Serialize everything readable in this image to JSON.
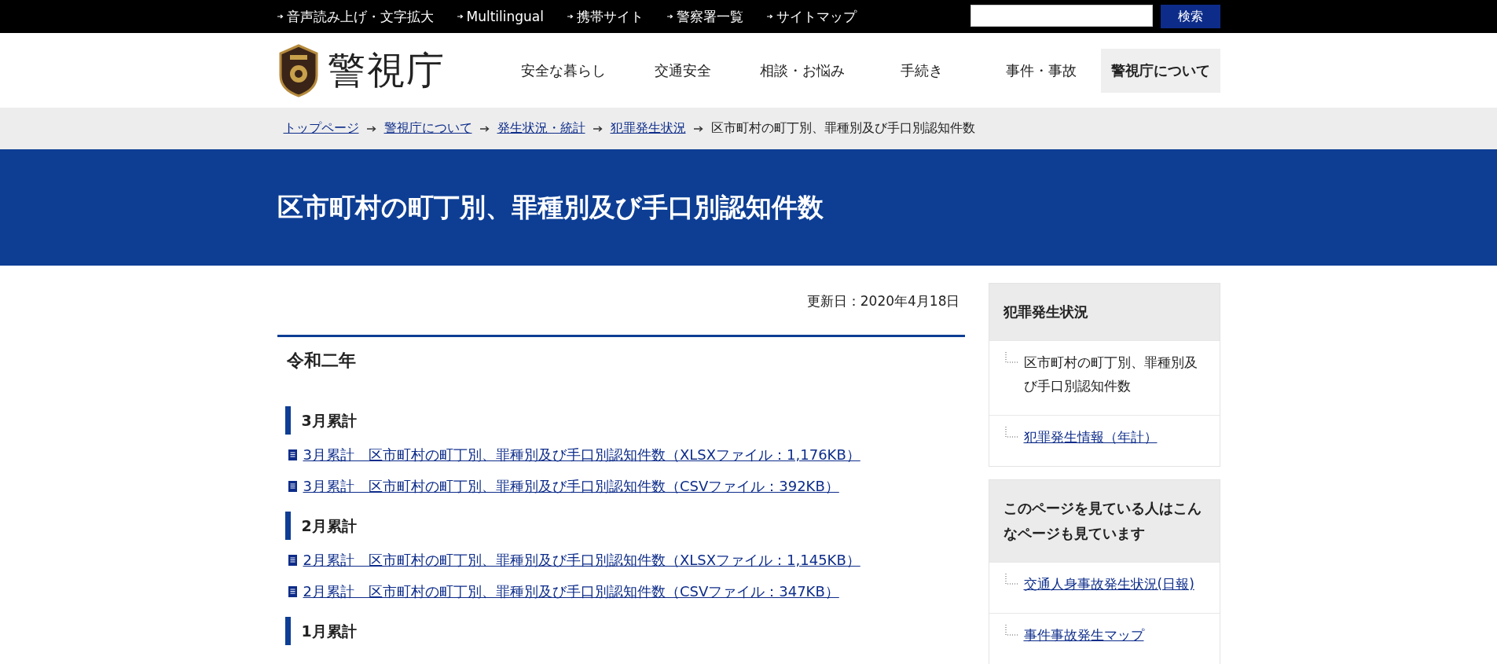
{
  "utility_bar": {
    "links": [
      "音声読み上げ・文字拡大",
      "Multilingual",
      "携帯サイト",
      "警察署一覧",
      "サイトマップ"
    ],
    "search": {
      "button": "検索"
    }
  },
  "header": {
    "logo_text": "警視庁",
    "nav": [
      {
        "label": "安全な暮らし",
        "selected": false
      },
      {
        "label": "交通安全",
        "selected": false
      },
      {
        "label": "相談・お悩み",
        "selected": false
      },
      {
        "label": "手続き",
        "selected": false
      },
      {
        "label": "事件・事故",
        "selected": false
      },
      {
        "label": "警視庁について",
        "selected": true
      }
    ]
  },
  "breadcrumb": [
    {
      "label": "トップページ",
      "kind": "link"
    },
    {
      "label": "警視庁について",
      "kind": "link"
    },
    {
      "label": "発生状況・統計",
      "kind": "link"
    },
    {
      "label": "犯罪発生状況",
      "kind": "link"
    },
    {
      "label": "区市町村の町丁別、罪種別及び手口別認知件数",
      "kind": "current"
    }
  ],
  "page_title": "区市町村の町丁別、罪種別及び手口別認知件数",
  "updated": "更新日：2020年4月18日",
  "year_heading": "令和二年",
  "sections": [
    {
      "heading": "3月累計",
      "files": [
        "3月累計　区市町村の町丁別、罪種別及び手口別認知件数（XLSXファイル：1,176KB）",
        "3月累計　区市町村の町丁別、罪種別及び手口別認知件数（CSVファイル：392KB）"
      ]
    },
    {
      "heading": "2月累計",
      "files": [
        "2月累計　区市町村の町丁別、罪種別及び手口別認知件数（XLSXファイル：1,145KB）",
        "2月累計　区市町村の町丁別、罪種別及び手口別認知件数（CSVファイル：347KB）"
      ]
    },
    {
      "heading": "1月累計"
    }
  ],
  "sidebar": [
    {
      "title": "犯罪発生状況",
      "items": [
        {
          "label": "区市町村の町丁別、罪種別及び手口別認知件数",
          "selected": true
        },
        {
          "label": "犯罪発生情報（年計）",
          "selected": false
        }
      ]
    },
    {
      "title": "このページを見ている人はこんなページも見ています",
      "items": [
        {
          "label": "交通人身事故発生状況(日報)",
          "selected": false
        },
        {
          "label": "事件事故発生マップ",
          "selected": false
        }
      ]
    }
  ]
}
